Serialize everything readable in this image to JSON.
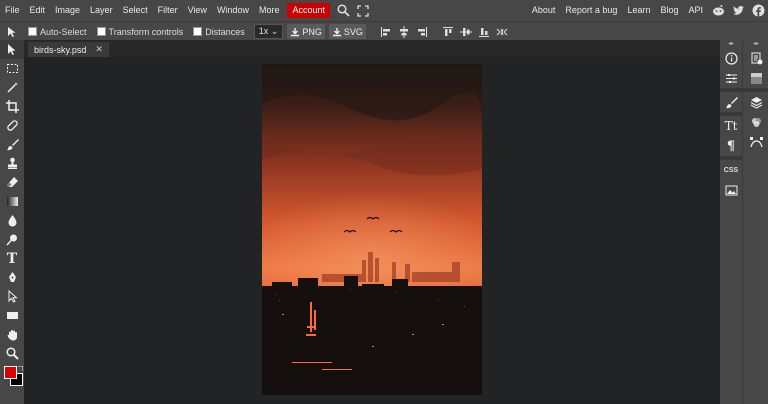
{
  "menu": {
    "items": [
      "File",
      "Edit",
      "Image",
      "Layer",
      "Select",
      "Filter",
      "View",
      "Window",
      "More"
    ],
    "account": "Account",
    "right_links": [
      "About",
      "Report a bug",
      "Learn",
      "Blog",
      "API"
    ]
  },
  "options": {
    "auto_select": "Auto-Select",
    "transform_controls": "Transform controls",
    "distances": "Distances",
    "zoom": "1x",
    "png": "PNG",
    "svg": "SVG"
  },
  "document": {
    "tab_name": "birds-sky.psd",
    "close_glyph": "✕"
  },
  "tools": {
    "text_glyph": "T",
    "right_text_glyph": "Tt",
    "paragraph_glyph": "¶",
    "css_label": "CSS",
    "info_glyph": "i"
  },
  "colors": {
    "foreground": "#e00000",
    "background": "#000000",
    "account_bg": "#cc0000"
  }
}
